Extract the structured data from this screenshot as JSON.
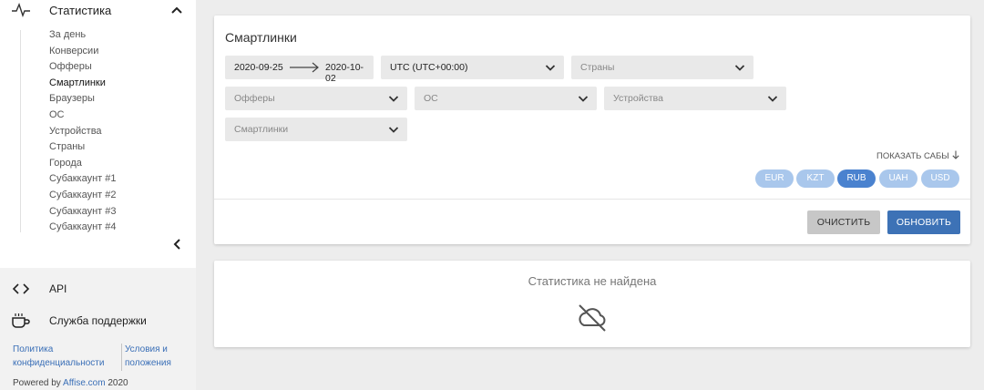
{
  "sidebar": {
    "statistics": {
      "label": "Статистика",
      "icon": "activity-icon",
      "expand_icon": "chevron-up-icon"
    },
    "subnav": [
      {
        "label": "За день"
      },
      {
        "label": "Конверсии"
      },
      {
        "label": "Офферы"
      },
      {
        "label": "Смартлинки",
        "active": true
      },
      {
        "label": "Браузеры"
      },
      {
        "label": "ОС"
      },
      {
        "label": "Устройства"
      },
      {
        "label": "Страны"
      },
      {
        "label": "Города"
      },
      {
        "label": "Субаккаунт #1"
      },
      {
        "label": "Субаккаунт #2"
      },
      {
        "label": "Субаккаунт #3"
      },
      {
        "label": "Субаккаунт #4"
      }
    ],
    "collapse_icon": "chevron-left-icon",
    "api": {
      "label": "API",
      "icon": "code-icon"
    },
    "support": {
      "label": "Служба поддержки",
      "icon": "coffee-cup-icon"
    },
    "footer": {
      "policy": "Политика конфиденциальности",
      "terms": "Условия и положения",
      "powered_prefix": "Powered by",
      "powered_brand": "Affise.com",
      "powered_year": "2020"
    }
  },
  "filters": {
    "title": "Смартлинки",
    "date_from": "2020-09-25",
    "date_to": "2020-10-02",
    "timezone": "UTC (UTC+00:00)",
    "countries_placeholder": "Страны",
    "offers_placeholder": "Офферы",
    "os_placeholder": "ОС",
    "devices_placeholder": "Устройства",
    "smartlinks_placeholder": "Смартлинки",
    "show_subs": "ПОКАЗАТЬ САБЫ",
    "currencies": [
      {
        "code": "EUR",
        "selected": false
      },
      {
        "code": "KZT",
        "selected": false
      },
      {
        "code": "RUB",
        "selected": true
      },
      {
        "code": "UAH",
        "selected": false
      },
      {
        "code": "USD",
        "selected": false
      }
    ],
    "clear_label": "ОЧИСТИТЬ",
    "update_label": "ОБНОВИТЬ"
  },
  "results": {
    "empty_text": "Статистика не найдена",
    "icon": "cloud-off-icon"
  },
  "colors": {
    "accent": "#3d72b6",
    "currency_active": "#4a82cf",
    "currency_inactive": "#a9c7ec",
    "link": "#3a6fb7"
  }
}
